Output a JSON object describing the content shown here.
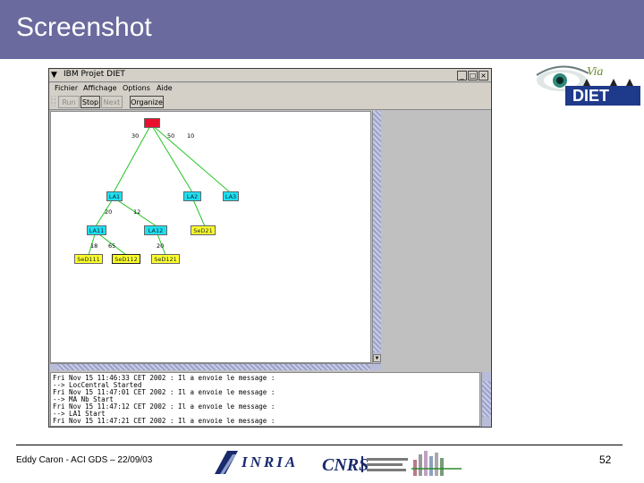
{
  "slide": {
    "title": "Screenshot",
    "footer_author": "Eddy Caron - ACI GDS – 22/09/03",
    "page_number": "52"
  },
  "logos": {
    "top_right": "Via DIET logo (eye image)",
    "inria": "INRIA",
    "cnrs": "CNRS",
    "lab": "laboratory logo"
  },
  "app": {
    "window_title": "IBM Projet DIET",
    "menu": [
      "Fichier",
      "Affichage",
      "Options",
      "Aide"
    ],
    "toolbar": {
      "run": "Run",
      "stop": "Stop",
      "next": "Next",
      "organize": "Organize"
    },
    "tree": {
      "root": "",
      "level1": [
        "LA1",
        "LA2",
        "LA3"
      ],
      "level2": [
        "LA11",
        "LA12",
        "SeD21"
      ],
      "leaves": [
        "SeD111",
        "SeD112",
        "SeD121"
      ],
      "edge_labels": [
        "30",
        "50",
        "10",
        "20",
        "12",
        "18",
        "65",
        "20"
      ]
    },
    "log_lines": [
      "Fri Nov 15 11:46:33 CET 2002 : Il a envoie le message :",
      "      --> LocCentral Started",
      "Fri Nov 15 11:47:01 CET 2002 : Il a envoie le message :",
      "      --> MA Nb Start",
      "Fri Nov 15 11:47:12 CET 2002 : Il a envoie le message :",
      "      --> LA1 Start",
      "Fri Nov 15 11:47:21 CET 2002 : Il a envoie le message :"
    ],
    "colors": {
      "root_node": "#e8102c",
      "agent_node": "#1ee0f0",
      "server_node": "#ffff2a",
      "edge": "#22c422"
    }
  }
}
